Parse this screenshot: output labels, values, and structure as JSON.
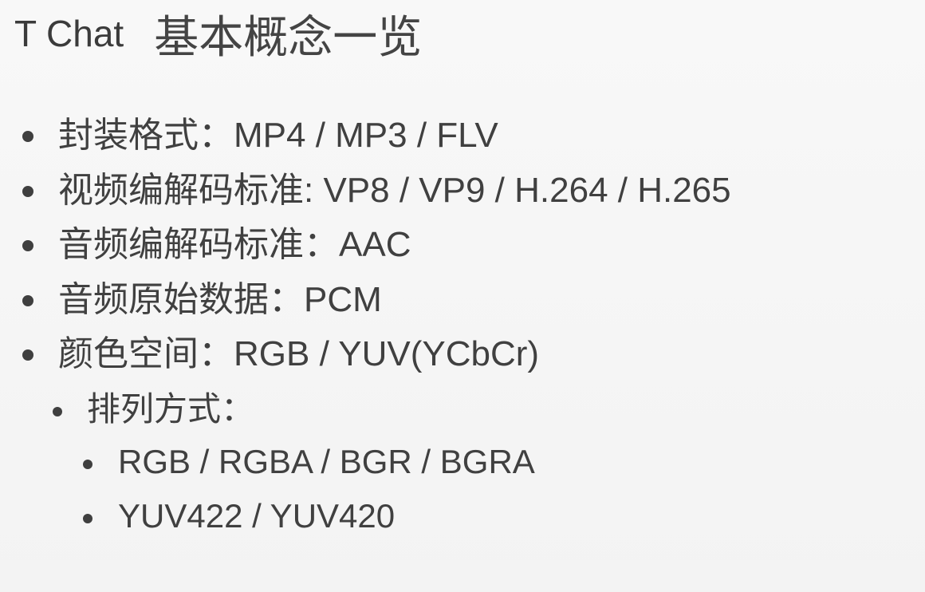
{
  "header": {
    "brand": "T Chat",
    "title": "基本概念一览"
  },
  "bullets": [
    {
      "level": 0,
      "text": "封装格式：MP4 / MP3 / FLV"
    },
    {
      "level": 0,
      "text": "视频编解码标准: VP8 / VP9 / H.264 / H.265"
    },
    {
      "level": 0,
      "text": "音频编解码标准：AAC"
    },
    {
      "level": 0,
      "text": "音频原始数据：PCM"
    },
    {
      "level": 0,
      "text": "颜色空间：RGB / YUV(YCbCr)"
    },
    {
      "level": 1,
      "text": "排列方式："
    },
    {
      "level": 2,
      "text": "RGB / RGBA / BGR / BGRA"
    },
    {
      "level": 2,
      "text": "YUV422 / YUV420"
    }
  ]
}
